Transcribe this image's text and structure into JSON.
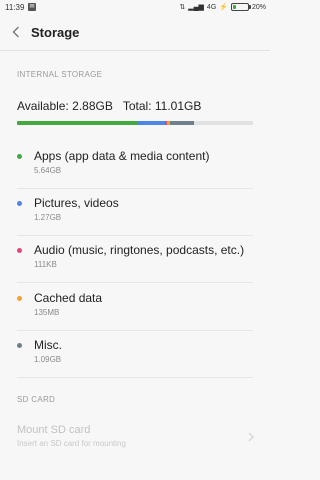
{
  "status_bar": {
    "time": "11:39",
    "network": "4G",
    "battery": "20%",
    "battery_level": 0.2
  },
  "header": {
    "title": "Storage",
    "back_icon": "chevron-left-icon"
  },
  "internal": {
    "section_label": "INTERNAL STORAGE",
    "available_text": "Available: 2.88GB",
    "total_text": "Total: 11.01GB",
    "bar_segments": [
      {
        "name": "Apps",
        "fraction": 0.512,
        "color": "#43a93f"
      },
      {
        "name": "Pictures",
        "fraction": 0.115,
        "color": "#4f86e3"
      },
      {
        "name": "Audio",
        "fraction": 0.01,
        "color": "#e0487a"
      },
      {
        "name": "Cached",
        "fraction": 0.012,
        "color": "#f0a236"
      },
      {
        "name": "Misc",
        "fraction": 0.099,
        "color": "#6f7f8c"
      }
    ],
    "items": [
      {
        "label": "Apps (app data & media content)",
        "size": "5.64GB",
        "color": "#43a93f"
      },
      {
        "label": "Pictures, videos",
        "size": "1.27GB",
        "color": "#4f86e3"
      },
      {
        "label": "Audio (music, ringtones, podcasts, etc.)",
        "size": "111KB",
        "color": "#e0487a"
      },
      {
        "label": "Cached data",
        "size": "135MB",
        "color": "#f0a236"
      },
      {
        "label": "Misc.",
        "size": "1.09GB",
        "color": "#6f7f8c"
      }
    ]
  },
  "sd_card": {
    "section_label": "SD CARD",
    "mount_label": "Mount SD card",
    "mount_sub": "Insert an SD card for mounting"
  }
}
